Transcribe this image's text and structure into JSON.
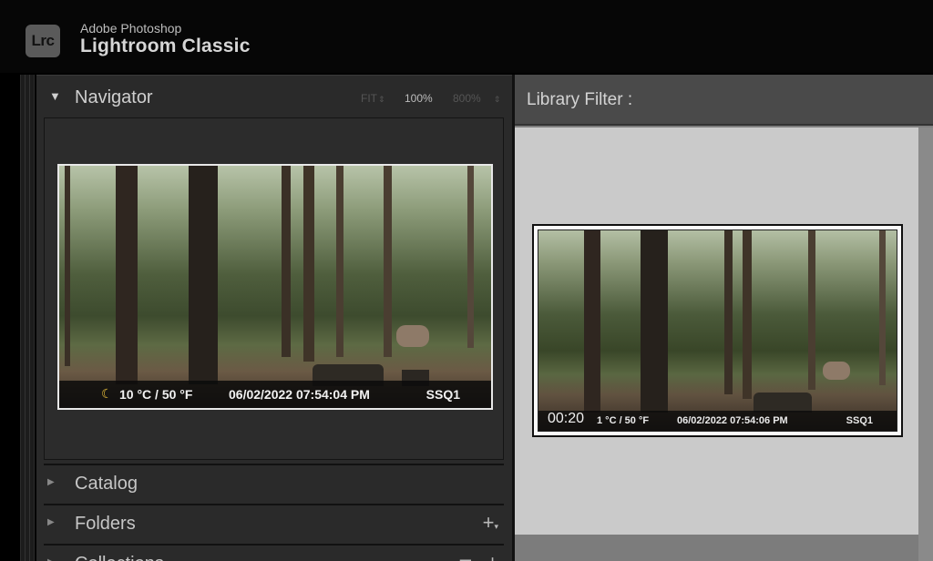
{
  "app": {
    "logo_text": "Lrc",
    "brand_small": "Adobe Photoshop",
    "brand_big": "Lightroom Classic"
  },
  "navigator": {
    "title": "Navigator",
    "zoom_options": [
      "FIT",
      "100%",
      "800%"
    ],
    "active_zoom": "100%",
    "photo_overlay": {
      "moon_icon": "crescent-moon-icon",
      "temperature": "10 °C / 50 °F",
      "datetime": "06/02/2022 07:54:04 PM",
      "camera": "SSQ1"
    }
  },
  "sections": {
    "catalog": "Catalog",
    "folders": "Folders",
    "collections": "Collections"
  },
  "library_filter": {
    "label": "Library Filter :"
  },
  "grid": {
    "thumbnail": {
      "duration": "00:20",
      "temperature": "1 °C / 50 °F",
      "datetime": "06/02/2022 07:54:06 PM",
      "camera": "SSQ1"
    }
  },
  "colors": {
    "panel_bg": "#2a2a2a",
    "grid_bg": "#cacaca",
    "moon": "#f0c43c"
  }
}
